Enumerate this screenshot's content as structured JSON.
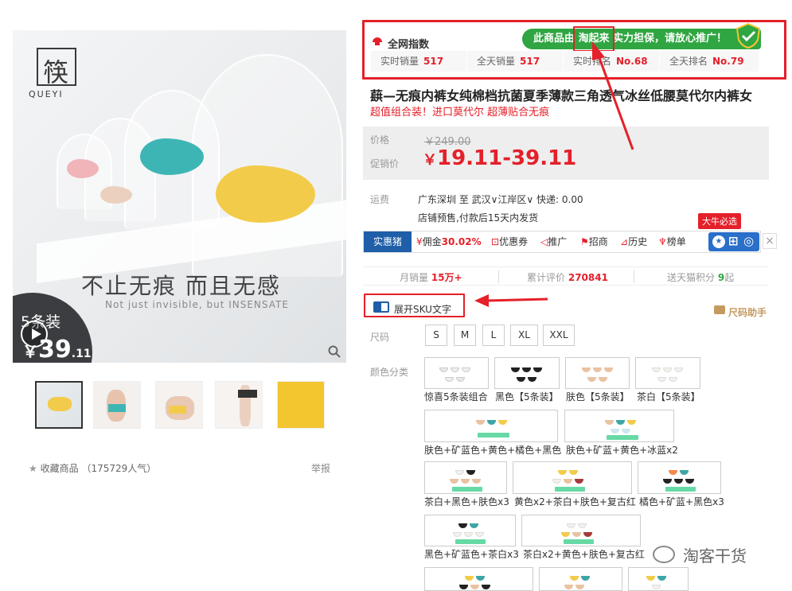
{
  "product_image": {
    "brand_logo": "筷",
    "brand_sub": "QUEYI",
    "slogan": "不止无痕 而且无感",
    "slogan_en": "Not just invisible, but INSENSATE",
    "pack_label": "5条装",
    "pack_price_symbol": "￥",
    "pack_price_int": "39",
    "pack_price_dec": ".11",
    "icons": [
      "play-icon",
      "search-icon"
    ]
  },
  "thumbnails": {
    "count": 5,
    "selected": 0
  },
  "left_footer": {
    "favorite_label": "收藏商品",
    "popularity": "（175729人气）",
    "report_label": "举报"
  },
  "index_panel": {
    "title": "全网指数",
    "banner": "此商品由 淘起来 实力担保，请放心推广！",
    "stats": [
      {
        "label": "实时销量",
        "value": "517"
      },
      {
        "label": "全天销量",
        "value": "517"
      },
      {
        "label": "实时排名",
        "value": "No.68"
      },
      {
        "label": "全天排名",
        "value": "No.79"
      }
    ]
  },
  "product": {
    "title": "蕻—无痕内裤女纯棉档抗菌夏季薄款三角透气冰丝低腰莫代尔内裤女",
    "subtitle": "超值组合装！进口莫代尔 超薄贴合无痕",
    "price_label": "价格",
    "original_price": "￥249.00",
    "promo_label": "促销价",
    "promo_currency": "￥",
    "promo_price": "19.11-39.11"
  },
  "shipping": {
    "label": "运费",
    "route": "广东深圳 至 武汉∨江岸区∨ 快递: 0.00",
    "note": "店铺预售,付款后15天内发货"
  },
  "toolbar": {
    "main": "实惠猪",
    "commission_label": "佣金",
    "commission_value": "30.02%",
    "items": [
      "优惠券",
      "推广",
      "招商",
      "历史",
      "榜单"
    ],
    "hot_badge": "大牛必选",
    "close": "×"
  },
  "sales": {
    "monthly_label": "月销量",
    "monthly_value": "15万+",
    "reviews_label": "累计评价",
    "reviews_value": "270841",
    "points_label": "送天猫积分",
    "points_value": "9",
    "points_unit": "起"
  },
  "sku": {
    "toggle_label": "展开SKU文字",
    "size_helper": "尺码助手",
    "size_label": "尺码",
    "sizes": [
      "S",
      "M",
      "L",
      "XL",
      "XXL"
    ],
    "color_label": "颜色分类",
    "colors": [
      "惊喜5条装组合",
      "黑色【5条装】",
      "肤色【5条装】",
      "茶白【5条装】",
      "肤色+矿蓝色+黄色+橘色+黑色",
      "肤色+矿蓝+黄色+冰蓝x2",
      "茶白+黑色+肤色x3",
      "黄色x2+茶白+肤色+复古红",
      "橘色+矿蓝+黑色x3",
      "黑色+矿蓝色+茶白x3",
      "茶白x2+黄色+肤色+复古红"
    ]
  },
  "watermark": "淘客干货",
  "colors": {
    "accent_red": "#e4202a",
    "brand_blue": "#1f5ea8",
    "banner_green": "#2fa641"
  }
}
